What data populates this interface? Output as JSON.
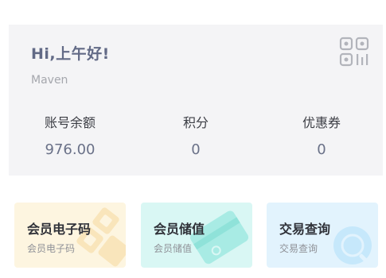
{
  "account": {
    "greeting": "Hi,上午好!",
    "username": "Maven",
    "stats": [
      {
        "label": "账号余额",
        "value": "976.00"
      },
      {
        "label": "积分",
        "value": "0"
      },
      {
        "label": "优惠券",
        "value": "0"
      }
    ]
  },
  "tiles": [
    {
      "title": "会员电子码",
      "subtitle": "会员电子码",
      "bg": "#fdf5e0",
      "icon": "member-code-icon"
    },
    {
      "title": "会员储值",
      "subtitle": "会员储值",
      "bg": "#d9f7f4",
      "icon": "stored-value-card-icon"
    },
    {
      "title": "交易查询",
      "subtitle": "交易查询",
      "bg": "#e2f3fd",
      "icon": "search-magnifier-icon"
    }
  ],
  "colors": {
    "card_bg": "#f4f4f6",
    "greeting": "#626a86",
    "value": "#6a7188"
  }
}
